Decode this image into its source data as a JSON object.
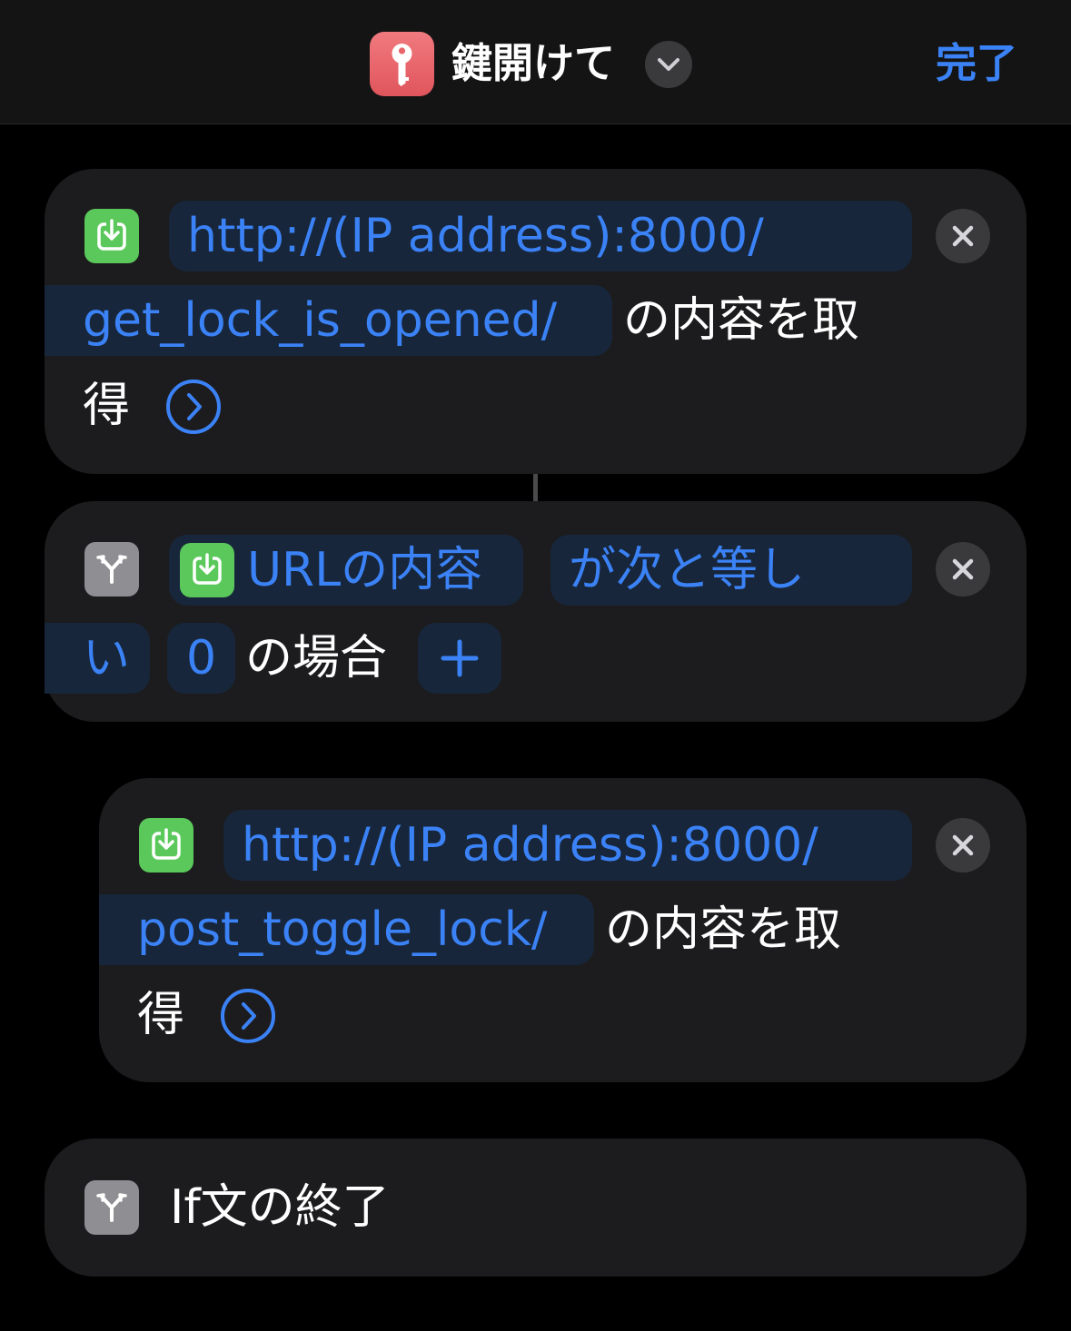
{
  "header": {
    "shortcut_title": "鍵開けて",
    "done_label": "完了",
    "app_icon": "key-icon",
    "title_menu_icon": "chevron-down-icon",
    "app_icon_color": "#e8646a"
  },
  "actions": [
    {
      "type": "get_contents_of_url",
      "icon": "download-icon",
      "icon_color": "#5ac85a",
      "url_part1": "http://(IP address):8000/",
      "url_part2": "get_lock_is_opened/",
      "label_a": "の内容を取",
      "label_b": "得",
      "expand_icon": "chevron-right-circle-icon",
      "remove_icon": "close-icon"
    },
    {
      "type": "if",
      "icon": "branch-icon",
      "icon_color": "#8e8e93",
      "variable_icon": "download-icon",
      "variable_label": "URLの内容",
      "condition_part1": "が次と等し",
      "condition_part2": "い",
      "value": "0",
      "suffix": "の場合",
      "add_label": "+",
      "remove_icon": "close-icon"
    },
    {
      "type": "get_contents_of_url",
      "icon": "download-icon",
      "icon_color": "#5ac85a",
      "url_part1": "http://(IP address):8000/",
      "url_part2": "post_toggle_lock/",
      "label_a": "の内容を取",
      "label_b": "得",
      "expand_icon": "chevron-right-circle-icon",
      "remove_icon": "close-icon"
    },
    {
      "type": "end_if",
      "icon": "branch-icon",
      "icon_color": "#8e8e93",
      "label": "If文の終了"
    }
  ],
  "colors": {
    "accent": "#3b82f6",
    "card_bg": "#1c1c1e",
    "token_bg": "#17263a",
    "background": "#000000"
  }
}
